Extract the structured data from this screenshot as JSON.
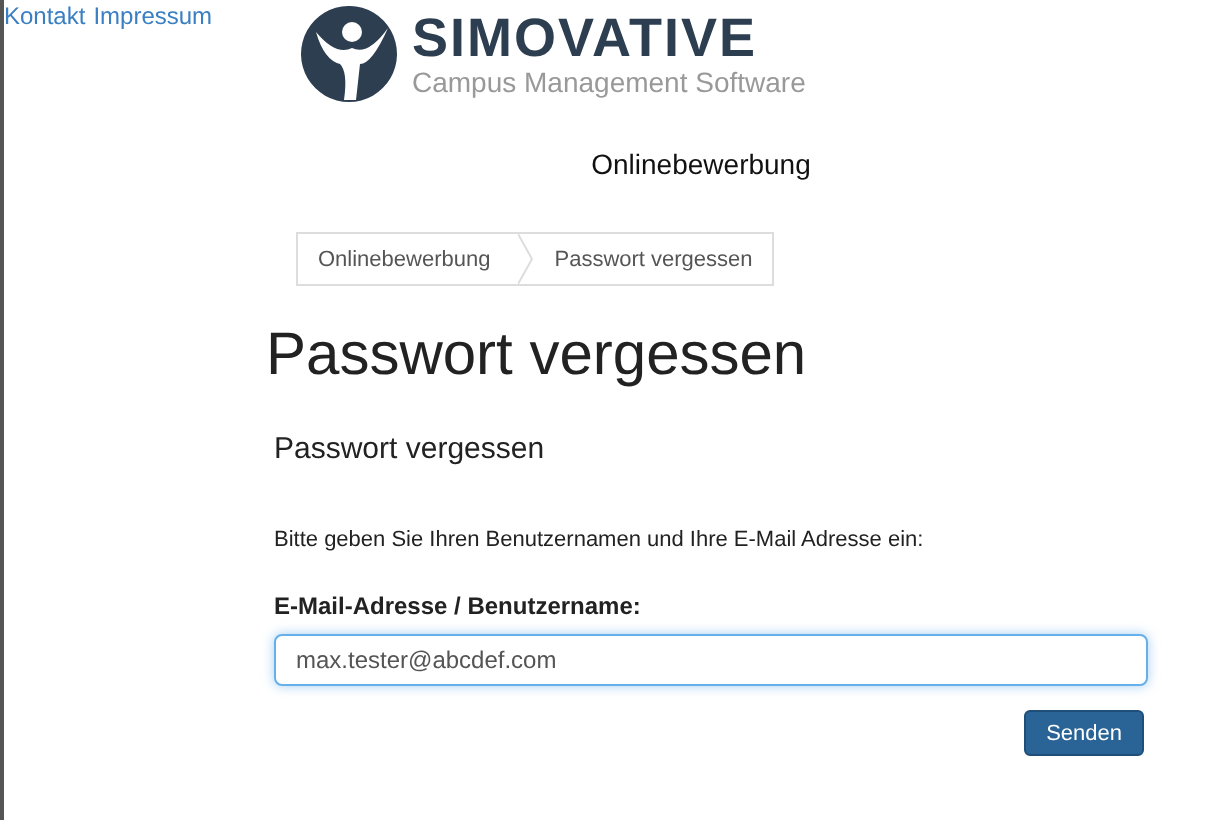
{
  "top_links": [
    "Kontakt",
    "Impressum"
  ],
  "logo": {
    "name": "SIMOVATIVE",
    "tagline": "Campus Management Software"
  },
  "app_title": "Onlinebewerbung",
  "breadcrumb": [
    {
      "label": "Onlinebewerbung"
    },
    {
      "label": "Passwort vergessen"
    }
  ],
  "page_heading": "Passwort vergessen",
  "panel_title": "Passwort vergessen",
  "instructions": "Bitte geben Sie Ihren Benutzernamen und Ihre E-Mail Adresse ein:",
  "field": {
    "label": "E-Mail-Adresse / Benutzername:",
    "value": "max.tester@abcdef.com",
    "focused": true
  },
  "buttons": [
    "Senden"
  ]
}
